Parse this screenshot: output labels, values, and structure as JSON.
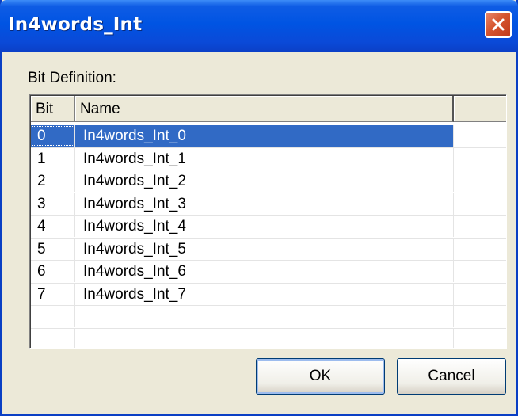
{
  "window": {
    "title": "In4words_Int",
    "close_icon": "close-icon"
  },
  "group_label": "Bit Definition:",
  "table": {
    "columns": [
      "Bit",
      "Name",
      ""
    ],
    "rows": [
      {
        "bit": "0",
        "name": "In4words_Int_0",
        "selected": true
      },
      {
        "bit": "1",
        "name": "In4words_Int_1",
        "selected": false
      },
      {
        "bit": "2",
        "name": "In4words_Int_2",
        "selected": false
      },
      {
        "bit": "3",
        "name": "In4words_Int_3",
        "selected": false
      },
      {
        "bit": "4",
        "name": "In4words_Int_4",
        "selected": false
      },
      {
        "bit": "5",
        "name": "In4words_Int_5",
        "selected": false
      },
      {
        "bit": "6",
        "name": "In4words_Int_6",
        "selected": false
      },
      {
        "bit": "7",
        "name": "In4words_Int_7",
        "selected": false
      },
      {
        "bit": "",
        "name": "",
        "selected": false
      },
      {
        "bit": "",
        "name": "",
        "selected": false
      }
    ]
  },
  "buttons": {
    "ok": "OK",
    "cancel": "Cancel"
  },
  "colors": {
    "titlebar": "#0054e3",
    "selection": "#316ac5",
    "dialog_bg": "#ece9d8"
  }
}
